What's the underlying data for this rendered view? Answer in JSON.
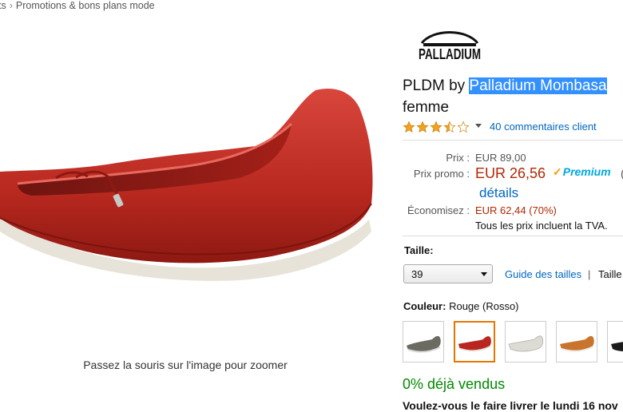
{
  "breadcrumb": {
    "prev": "ts",
    "separator": "›",
    "current": "Promotions & bons plans mode"
  },
  "brand_logo_text": "PALLADIUM",
  "product": {
    "title_prefix": "PLDM by ",
    "title_highlight": "Palladium Mombasa",
    "subtitle": "femme"
  },
  "rating": {
    "stars": 3.5,
    "reviews_link": "40 commentaires client"
  },
  "price": {
    "list_label": "Prix :",
    "list_value": "EUR 89,00",
    "promo_label": "Prix promo :",
    "promo_value": "EUR 26,56",
    "prime_label": "Premium",
    "prime_trail": "(",
    "details_link": "détails",
    "save_label": "Économisez :",
    "save_value": "EUR 62,44 (70%)",
    "tva_note": "Tous les prix incluent la TVA."
  },
  "size": {
    "label": "Taille:",
    "selected": "39",
    "guide_link": "Guide des tailles",
    "separator": "|",
    "more_text": "Taille"
  },
  "color": {
    "label": "Couleur:",
    "value": "Rouge (Rosso)",
    "swatches": [
      {
        "name": "grey",
        "color": "#6b6b62"
      },
      {
        "name": "red",
        "color": "#b8261f"
      },
      {
        "name": "white",
        "color": "#dcdcd4"
      },
      {
        "name": "tan",
        "color": "#c9742d"
      },
      {
        "name": "black",
        "color": "#1c1c1c"
      }
    ]
  },
  "sold_text": "0% déjà vendus",
  "delivery_text": "Voulez-vous le faire livrer le lundi 16 nov",
  "zoom_hint": "Passez la souris sur l'image pour zoomer",
  "colors": {
    "link": "#0066c0",
    "price": "#b12704",
    "highlight": "#3390ff",
    "prime": "#00a8e1",
    "sold": "#008a00"
  }
}
